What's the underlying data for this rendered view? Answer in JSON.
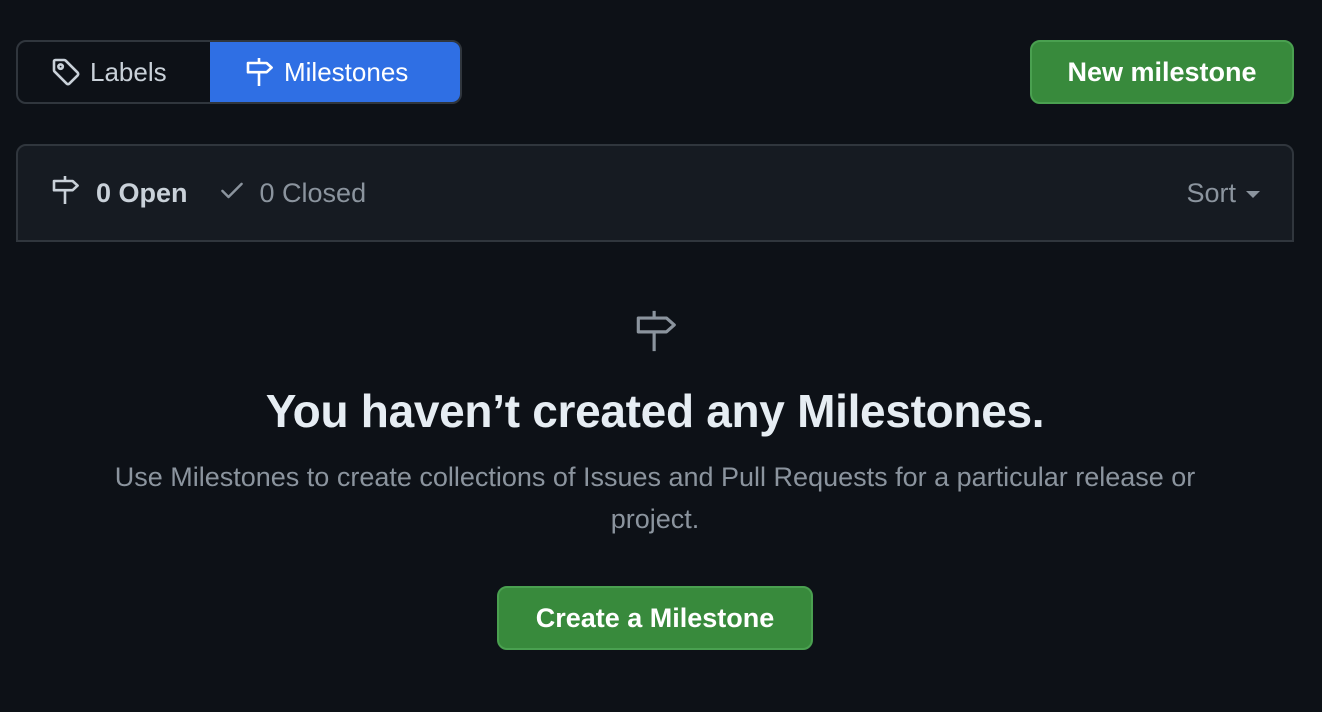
{
  "tabs": {
    "labels": "Labels",
    "milestones": "Milestones"
  },
  "header": {
    "new_milestone_label": "New milestone"
  },
  "filters": {
    "open_label": "0 Open",
    "closed_label": "0 Closed",
    "sort_label": "Sort"
  },
  "blankslate": {
    "title": "You haven’t created any Milestones.",
    "description": "Use Milestones to create collections of Issues and Pull Requests for a particular release or project.",
    "button_label": "Create a Milestone"
  },
  "icons": {
    "labels_tab": "tag-icon",
    "milestones_tab": "milestone-icon",
    "open_state": "milestone-icon",
    "closed_state": "check-icon",
    "sort": "caret-down-icon",
    "blankslate": "milestone-icon"
  },
  "colors": {
    "background": "#0d1117",
    "active_tab": "#2f6fe4",
    "primary_button": "#388a3c",
    "text_muted": "#8b949e"
  }
}
